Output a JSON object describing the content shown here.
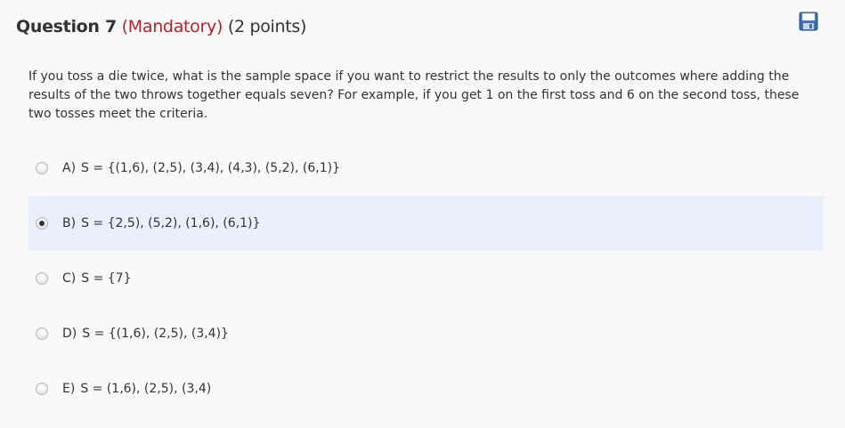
{
  "question": {
    "number_label": "Question 7",
    "mandatory_label": "(Mandatory)",
    "points_label": "(2 points)",
    "prompt": "If you toss a die twice, what is the sample space if you want to restrict the results to only the outcomes where adding the results of the two throws together equals seven? For example, if you get 1 on the first toss and 6 on the second toss, these two tosses meet the criteria."
  },
  "toolbar": {
    "save_icon": "floppy-disk-icon"
  },
  "colors": {
    "mandatory": "#b0252a",
    "selected_bg": "#e8f1fb",
    "page_bg": "#f9f9f9",
    "save_icon_blue": "#3a6fb5"
  },
  "options": [
    {
      "letter": "A)",
      "text": "S = {(1,6), (2,5), (3,4), (4,3), (5,2), (6,1)}",
      "selected": false
    },
    {
      "letter": "B)",
      "text": "S = {2,5), (5,2), (1,6), (6,1)}",
      "selected": true
    },
    {
      "letter": "C)",
      "text": "S = {7}",
      "selected": false
    },
    {
      "letter": "D)",
      "text": "S = {(1,6), (2,5), (3,4)}",
      "selected": false
    },
    {
      "letter": "E)",
      "text": "S = (1,6), (2,5), (3,4)",
      "selected": false
    }
  ]
}
